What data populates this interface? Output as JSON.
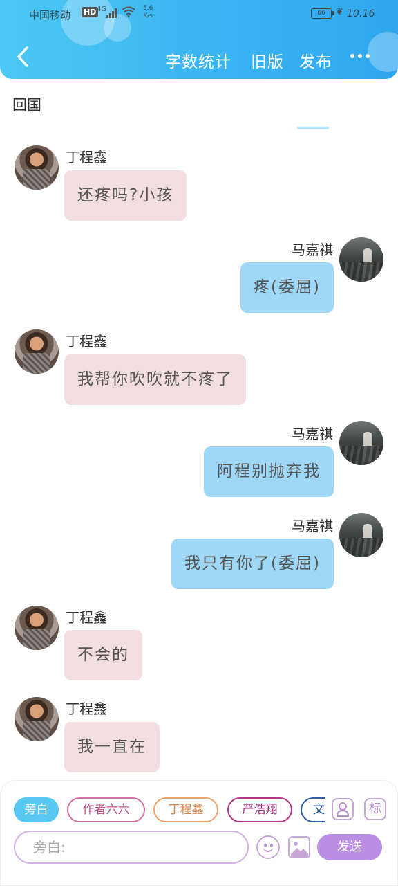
{
  "status_bar": {
    "carrier": "中国移动",
    "hd": "HD",
    "network": "4G",
    "speed_value": "5.6",
    "speed_unit": "K/s",
    "battery": "66",
    "time": "10:16"
  },
  "header": {
    "word_count": "字数统计",
    "old_version": "旧版",
    "publish": "发布",
    "colors": {
      "gradient_start": "#4cc9f4",
      "gradient_end": "#2fa7f0"
    }
  },
  "chat": {
    "title": "回国",
    "messages": [
      {
        "side": "left",
        "sender": "丁程鑫",
        "text": "还疼吗?小孩",
        "avatar": "ding-avatar"
      },
      {
        "side": "right",
        "sender": "马嘉祺",
        "text": "疼(委屈)",
        "avatar": "ma-avatar"
      },
      {
        "side": "left",
        "sender": "丁程鑫",
        "text": "我帮你吹吹就不疼了",
        "avatar": "ding-avatar"
      },
      {
        "side": "right",
        "sender": "马嘉祺",
        "text": "阿程别抛弃我",
        "avatar": "ma-avatar"
      },
      {
        "side": "right",
        "sender": "马嘉祺",
        "text": "我只有你了(委屈)",
        "avatar": "ma-avatar"
      },
      {
        "side": "left",
        "sender": "丁程鑫",
        "text": "不会的",
        "avatar": "ding-avatar"
      },
      {
        "side": "left",
        "sender": "丁程鑫",
        "text": "我一直在",
        "avatar": "ding-avatar"
      }
    ],
    "colors": {
      "left_bubble": "#f2dde0",
      "right_bubble": "#9fd8f7"
    }
  },
  "composer": {
    "roles": [
      "旁白",
      "作者六六",
      "丁程鑫",
      "严浩翔",
      "文"
    ],
    "active_role": "旁白",
    "profile_icon": "person-icon",
    "tag_label": "标",
    "input_placeholder": "旁白:",
    "emoji_icon": "smiley-icon",
    "image_icon": "picture-icon",
    "send_label": "发送",
    "colors": {
      "accent": "#b98ee3",
      "active_role": "#56c8f2"
    }
  }
}
